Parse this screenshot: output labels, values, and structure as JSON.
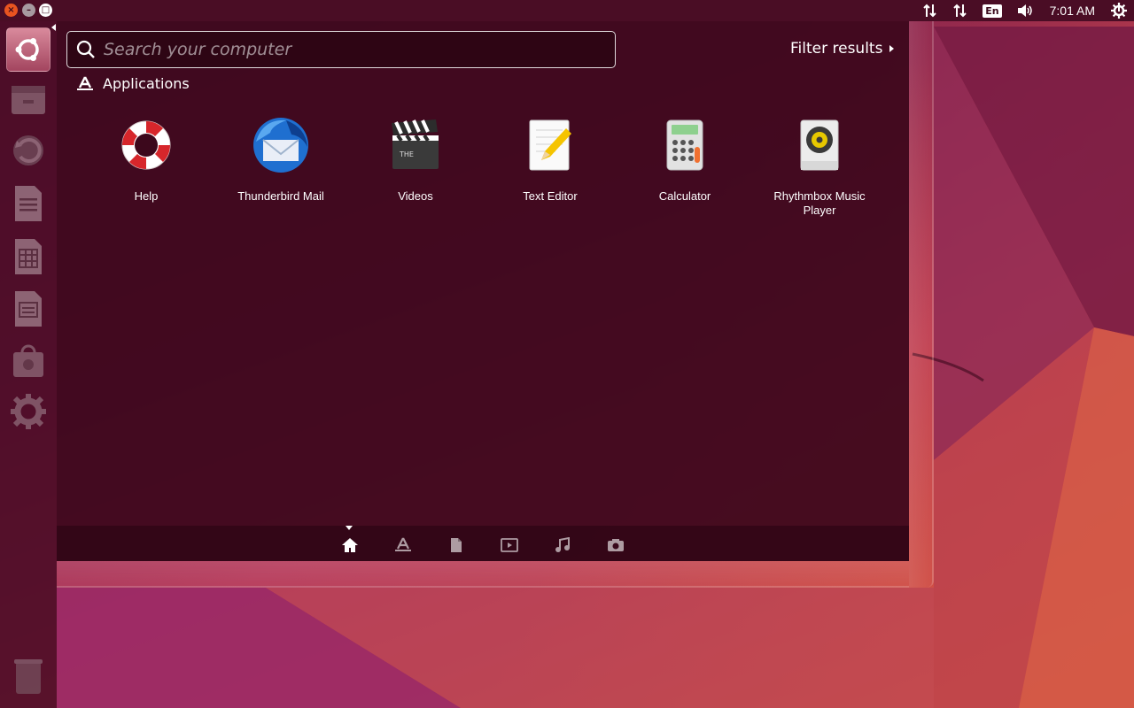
{
  "top_panel": {
    "language_indicator": "En",
    "clock": "7:01 AM",
    "icons": [
      "network-up-down-icon",
      "network-up-down-icon",
      "language-indicator",
      "volume-icon",
      "session-gear-icon"
    ]
  },
  "window_controls": {
    "close": "×",
    "minimize": "–",
    "maximize": "□"
  },
  "launcher": {
    "items": [
      "ubuntu-dash-icon",
      "files-icon",
      "backup-icon",
      "writer-icon",
      "calc-spreadsheet-icon",
      "impress-icon",
      "software-center-icon",
      "system-settings-icon",
      "trash-icon"
    ]
  },
  "dash": {
    "search": {
      "placeholder": "Search your computer",
      "value": ""
    },
    "filter_label": "Filter results",
    "category": "Applications",
    "apps": [
      {
        "label": "Help",
        "icon": "help-lifebuoy-icon"
      },
      {
        "label": "Thunderbird Mail",
        "icon": "thunderbird-icon"
      },
      {
        "label": "Videos",
        "icon": "clapperboard-icon"
      },
      {
        "label": "Text Editor",
        "icon": "text-editor-icon"
      },
      {
        "label": "Calculator",
        "icon": "calculator-icon"
      },
      {
        "label": "Rhythmbox Music Player",
        "icon": "rhythmbox-speaker-icon"
      }
    ],
    "lenses": [
      "home-icon",
      "applications-icon",
      "files-icon",
      "video-icon",
      "music-icon",
      "photos-icon"
    ]
  },
  "colors": {
    "accent": "#e95420",
    "panel": "#4a0d25",
    "dash_bg": "#3c081c"
  }
}
